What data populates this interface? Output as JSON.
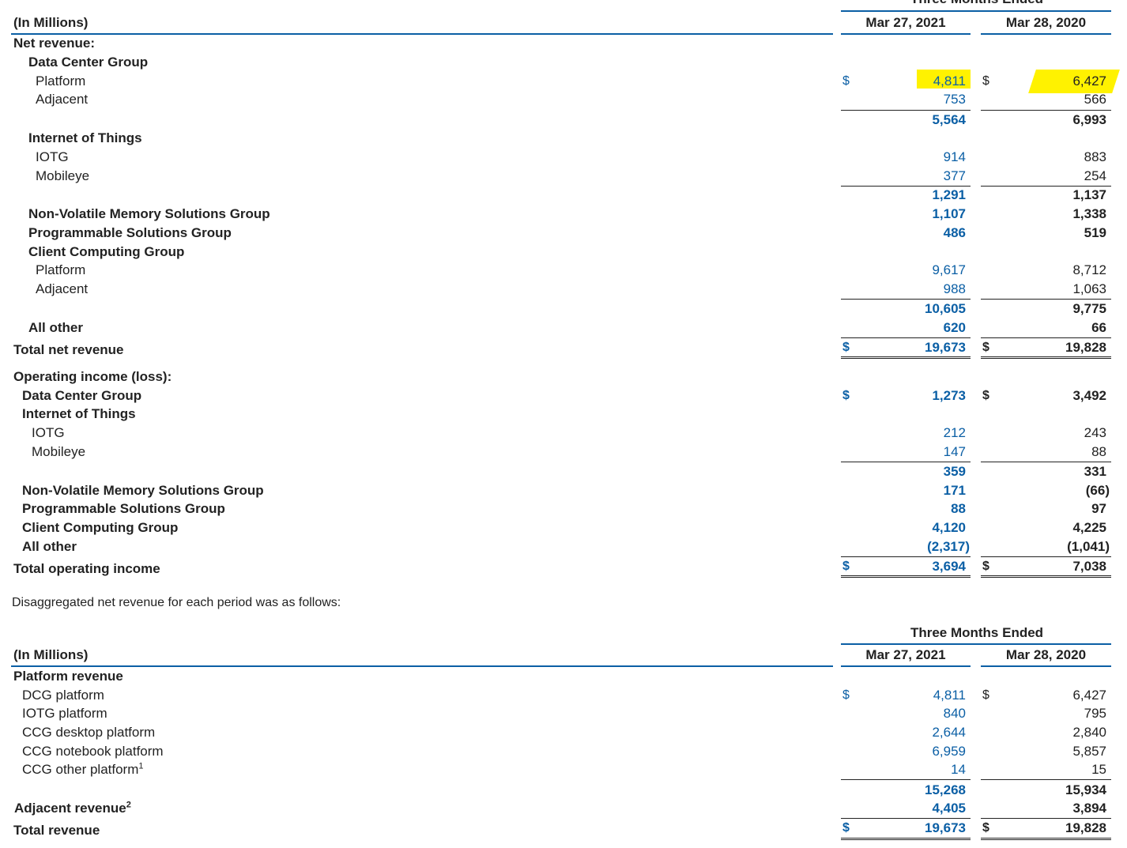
{
  "table1": {
    "group_header": "Three Months Ended",
    "units_label": "(In Millions)",
    "col1_header": "Mar 27, 2021",
    "col2_header": "Mar 28, 2020",
    "currency": "$",
    "rows": {
      "net_revenue": {
        "label": "Net revenue:"
      },
      "dcg": {
        "label": "Data Center Group"
      },
      "dcg_platform": {
        "label": "Platform",
        "v1": "4,811",
        "v2": "6,427"
      },
      "dcg_adjacent": {
        "label": "Adjacent",
        "v1": "753",
        "v2": "566"
      },
      "dcg_total": {
        "v1": "5,564",
        "v2": "6,993"
      },
      "iot": {
        "label": "Internet of Things"
      },
      "iotg": {
        "label": "IOTG",
        "v1": "914",
        "v2": "883"
      },
      "mobileye": {
        "label": "Mobileye",
        "v1": "377",
        "v2": "254"
      },
      "iot_total": {
        "v1": "1,291",
        "v2": "1,137"
      },
      "nsg": {
        "label": "Non-Volatile Memory Solutions Group",
        "v1": "1,107",
        "v2": "1,338"
      },
      "psg": {
        "label": "Programmable Solutions Group",
        "v1": "486",
        "v2": "519"
      },
      "ccg": {
        "label": "Client Computing Group"
      },
      "ccg_platform": {
        "label": "Platform",
        "v1": "9,617",
        "v2": "8,712"
      },
      "ccg_adjacent": {
        "label": "Adjacent",
        "v1": "988",
        "v2": "1,063"
      },
      "ccg_total": {
        "v1": "10,605",
        "v2": "9,775"
      },
      "all_other": {
        "label": "All other",
        "v1": "620",
        "v2": "66"
      },
      "total_net_revenue": {
        "label": "Total net revenue",
        "v1": "19,673",
        "v2": "19,828"
      },
      "op_income": {
        "label": "Operating income (loss):"
      },
      "op_dcg": {
        "label": "Data Center Group",
        "v1": "1,273",
        "v2": "3,492"
      },
      "op_iot": {
        "label": "Internet of Things"
      },
      "op_iotg": {
        "label": "IOTG",
        "v1": "212",
        "v2": "243"
      },
      "op_mobileye": {
        "label": "Mobileye",
        "v1": "147",
        "v2": "88"
      },
      "op_iot_total": {
        "v1": "359",
        "v2": "331"
      },
      "op_nsg": {
        "label": "Non-Volatile Memory Solutions Group",
        "v1": "171",
        "v2": "(66)"
      },
      "op_psg": {
        "label": "Programmable Solutions Group",
        "v1": "88",
        "v2": "97"
      },
      "op_ccg": {
        "label": "Client Computing Group",
        "v1": "4,120",
        "v2": "4,225"
      },
      "op_all_other": {
        "label": "All other",
        "v1": "(2,317)",
        "v2": "(1,041)"
      },
      "total_op_income": {
        "label": "Total operating income",
        "v1": "3,694",
        "v2": "7,038"
      }
    }
  },
  "intro_text": "Disaggregated net revenue for each period was as follows:",
  "table2": {
    "group_header": "Three Months Ended",
    "units_label": "(In Millions)",
    "col1_header": "Mar 27, 2021",
    "col2_header": "Mar 28, 2020",
    "currency": "$",
    "rows": {
      "platform_revenue": {
        "label": "Platform revenue"
      },
      "dcg_platform": {
        "label": "DCG platform",
        "v1": "4,811",
        "v2": "6,427"
      },
      "iotg_platform": {
        "label": "IOTG platform",
        "v1": "840",
        "v2": "795"
      },
      "ccg_desktop": {
        "label": "CCG desktop platform",
        "v1": "2,644",
        "v2": "2,840"
      },
      "ccg_notebook": {
        "label": "CCG notebook platform",
        "v1": "6,959",
        "v2": "5,857"
      },
      "ccg_other": {
        "label": "CCG other platform",
        "sup": "1",
        "v1": "14",
        "v2": "15"
      },
      "platform_total": {
        "v1": "15,268",
        "v2": "15,934"
      },
      "adjacent_revenue": {
        "label": "Adjacent revenue",
        "sup": "2",
        "v1": "4,405",
        "v2": "3,894"
      },
      "total_revenue": {
        "label": "Total revenue",
        "v1": "19,673",
        "v2": "19,828"
      }
    }
  },
  "colors": {
    "accent_blue": "#0b5fa5",
    "highlight": "#fff200"
  }
}
